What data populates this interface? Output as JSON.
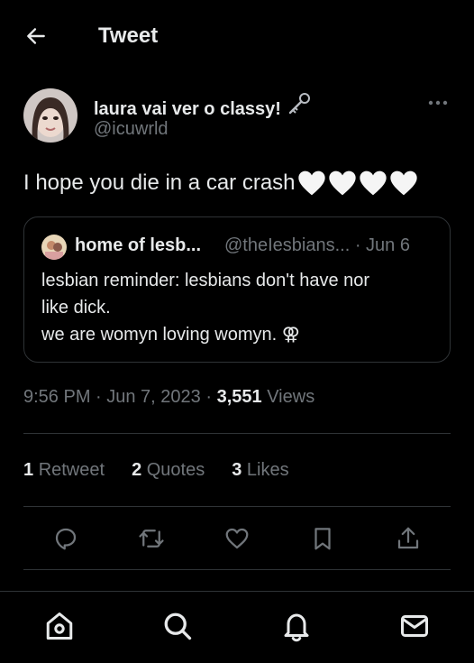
{
  "header": {
    "title": "Tweet",
    "back_icon": "arrow-left-icon"
  },
  "tweet": {
    "author_name": "laura vai ver o classy!",
    "author_handle": "@icuwrld",
    "text": "I hope you die in a car crash",
    "emoji": [
      "🤍",
      "🤍",
      "🤍",
      "🤍"
    ],
    "timestamp": "9:56 PM · Jun 7, 2023",
    "views_count": "3,551",
    "views_label": "Views"
  },
  "quote": {
    "author_name": "home of lesb...",
    "author_handle": "@theIesbians... · Jun 6",
    "lines": [
      "lesbian reminder: lesbians don't have nor",
      "like dick.",
      "we are womyn loving womyn. ⚢"
    ]
  },
  "stats": {
    "retweets_count": "1",
    "retweets_label": "Retweet",
    "quotes_count": "2",
    "quotes_label": "Quotes",
    "likes_count": "3",
    "likes_label": "Likes"
  },
  "actions": [
    "reply-icon",
    "retweet-icon",
    "heart-icon",
    "bookmark-icon",
    "share-icon"
  ],
  "bottom_nav": [
    "home-icon",
    "search-icon",
    "bell-icon",
    "mail-icon"
  ],
  "colors": {
    "background": "#000000",
    "text": "#e7e9ea",
    "muted": "#71767b",
    "border": "#2f3336"
  }
}
